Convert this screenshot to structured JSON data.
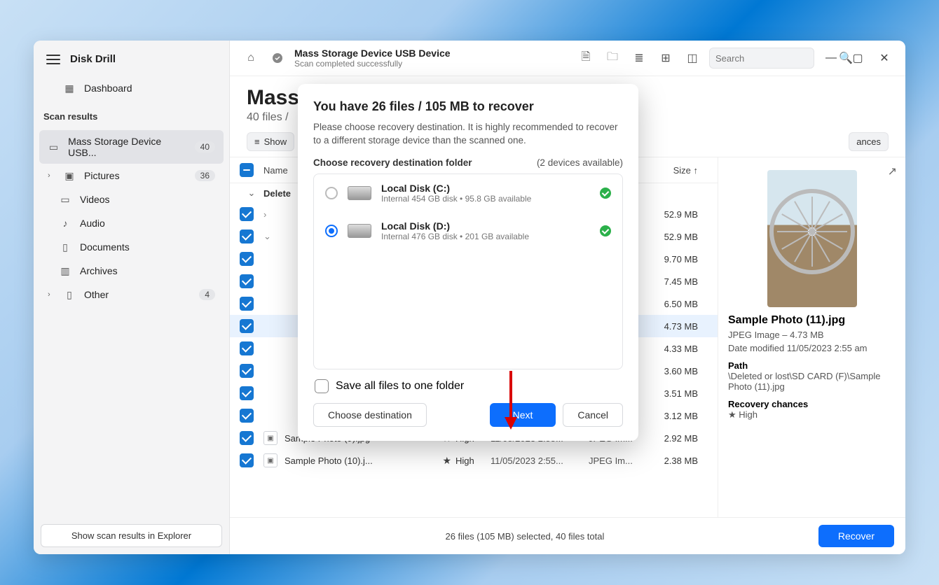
{
  "app": {
    "title": "Disk Drill"
  },
  "sidebar": {
    "dashboard": "Dashboard",
    "section": "Scan results",
    "items": {
      "device": {
        "label": "Mass Storage Device USB...",
        "count": "40"
      },
      "pictures": {
        "label": "Pictures",
        "count": "36"
      },
      "videos": {
        "label": "Videos"
      },
      "audio": {
        "label": "Audio"
      },
      "documents": {
        "label": "Documents"
      },
      "archives": {
        "label": "Archives"
      },
      "other": {
        "label": "Other",
        "count": "4"
      }
    },
    "explorer_btn": "Show scan results in Explorer"
  },
  "topbar": {
    "title": "Mass Storage Device USB Device",
    "subtitle": "Scan completed successfully",
    "search_placeholder": "Search"
  },
  "page": {
    "heading": "Mass",
    "sub": "40 files /",
    "show_btn": "Show",
    "other_chip": "ances"
  },
  "table": {
    "head": {
      "name": "Name",
      "size": "Size"
    },
    "deleted": "Delete",
    "rows": [
      {
        "name": "",
        "size": "52.9 MB"
      },
      {
        "name": "",
        "size": "52.9 MB"
      },
      {
        "name": "",
        "size": "9.70 MB"
      },
      {
        "name": "",
        "size": "7.45 MB"
      },
      {
        "name": "",
        "size": "6.50 MB"
      },
      {
        "name": "",
        "size": "4.73 MB",
        "sel": true
      },
      {
        "name": "",
        "size": "4.33 MB"
      },
      {
        "name": "",
        "size": "3.60 MB"
      },
      {
        "name": "",
        "size": "3.51 MB"
      },
      {
        "name": "",
        "size": "3.12 MB"
      },
      {
        "name": "Sample Photo (9).jpg",
        "rc": "High",
        "date": "11/05/2023 2:55...",
        "kind": "JPEG Im...",
        "size": "2.92 MB"
      },
      {
        "name": "Sample Photo (10).j...",
        "rc": "High",
        "date": "11/05/2023 2:55...",
        "kind": "JPEG Im...",
        "size": "2.38 MB"
      }
    ]
  },
  "details": {
    "filename": "Sample Photo (11).jpg",
    "meta": "JPEG Image – 4.73 MB",
    "modified": "Date modified 11/05/2023 2:55 am",
    "path_label": "Path",
    "path": "\\Deleted or lost\\SD CARD (F)\\Sample Photo (11).jpg",
    "rc_label": "Recovery chances",
    "rc": "High"
  },
  "footer": {
    "status": "26 files (105 MB) selected, 40 files total",
    "recover": "Recover"
  },
  "modal": {
    "title": "You have 26 files / 105 MB to recover",
    "desc": "Please choose recovery destination. It is highly recommended to recover to a different storage device than the scanned one.",
    "dest_label": "Choose recovery destination folder",
    "available": "(2 devices available)",
    "devices": [
      {
        "name": "Local Disk (C:)",
        "sub": "Internal 454 GB disk • 95.8 GB available",
        "selected": false
      },
      {
        "name": "Local Disk (D:)",
        "sub": "Internal 476 GB disk • 201 GB available",
        "selected": true
      }
    ],
    "save_one": "Save all files to one folder",
    "choose": "Choose destination",
    "next": "Next",
    "cancel": "Cancel"
  }
}
